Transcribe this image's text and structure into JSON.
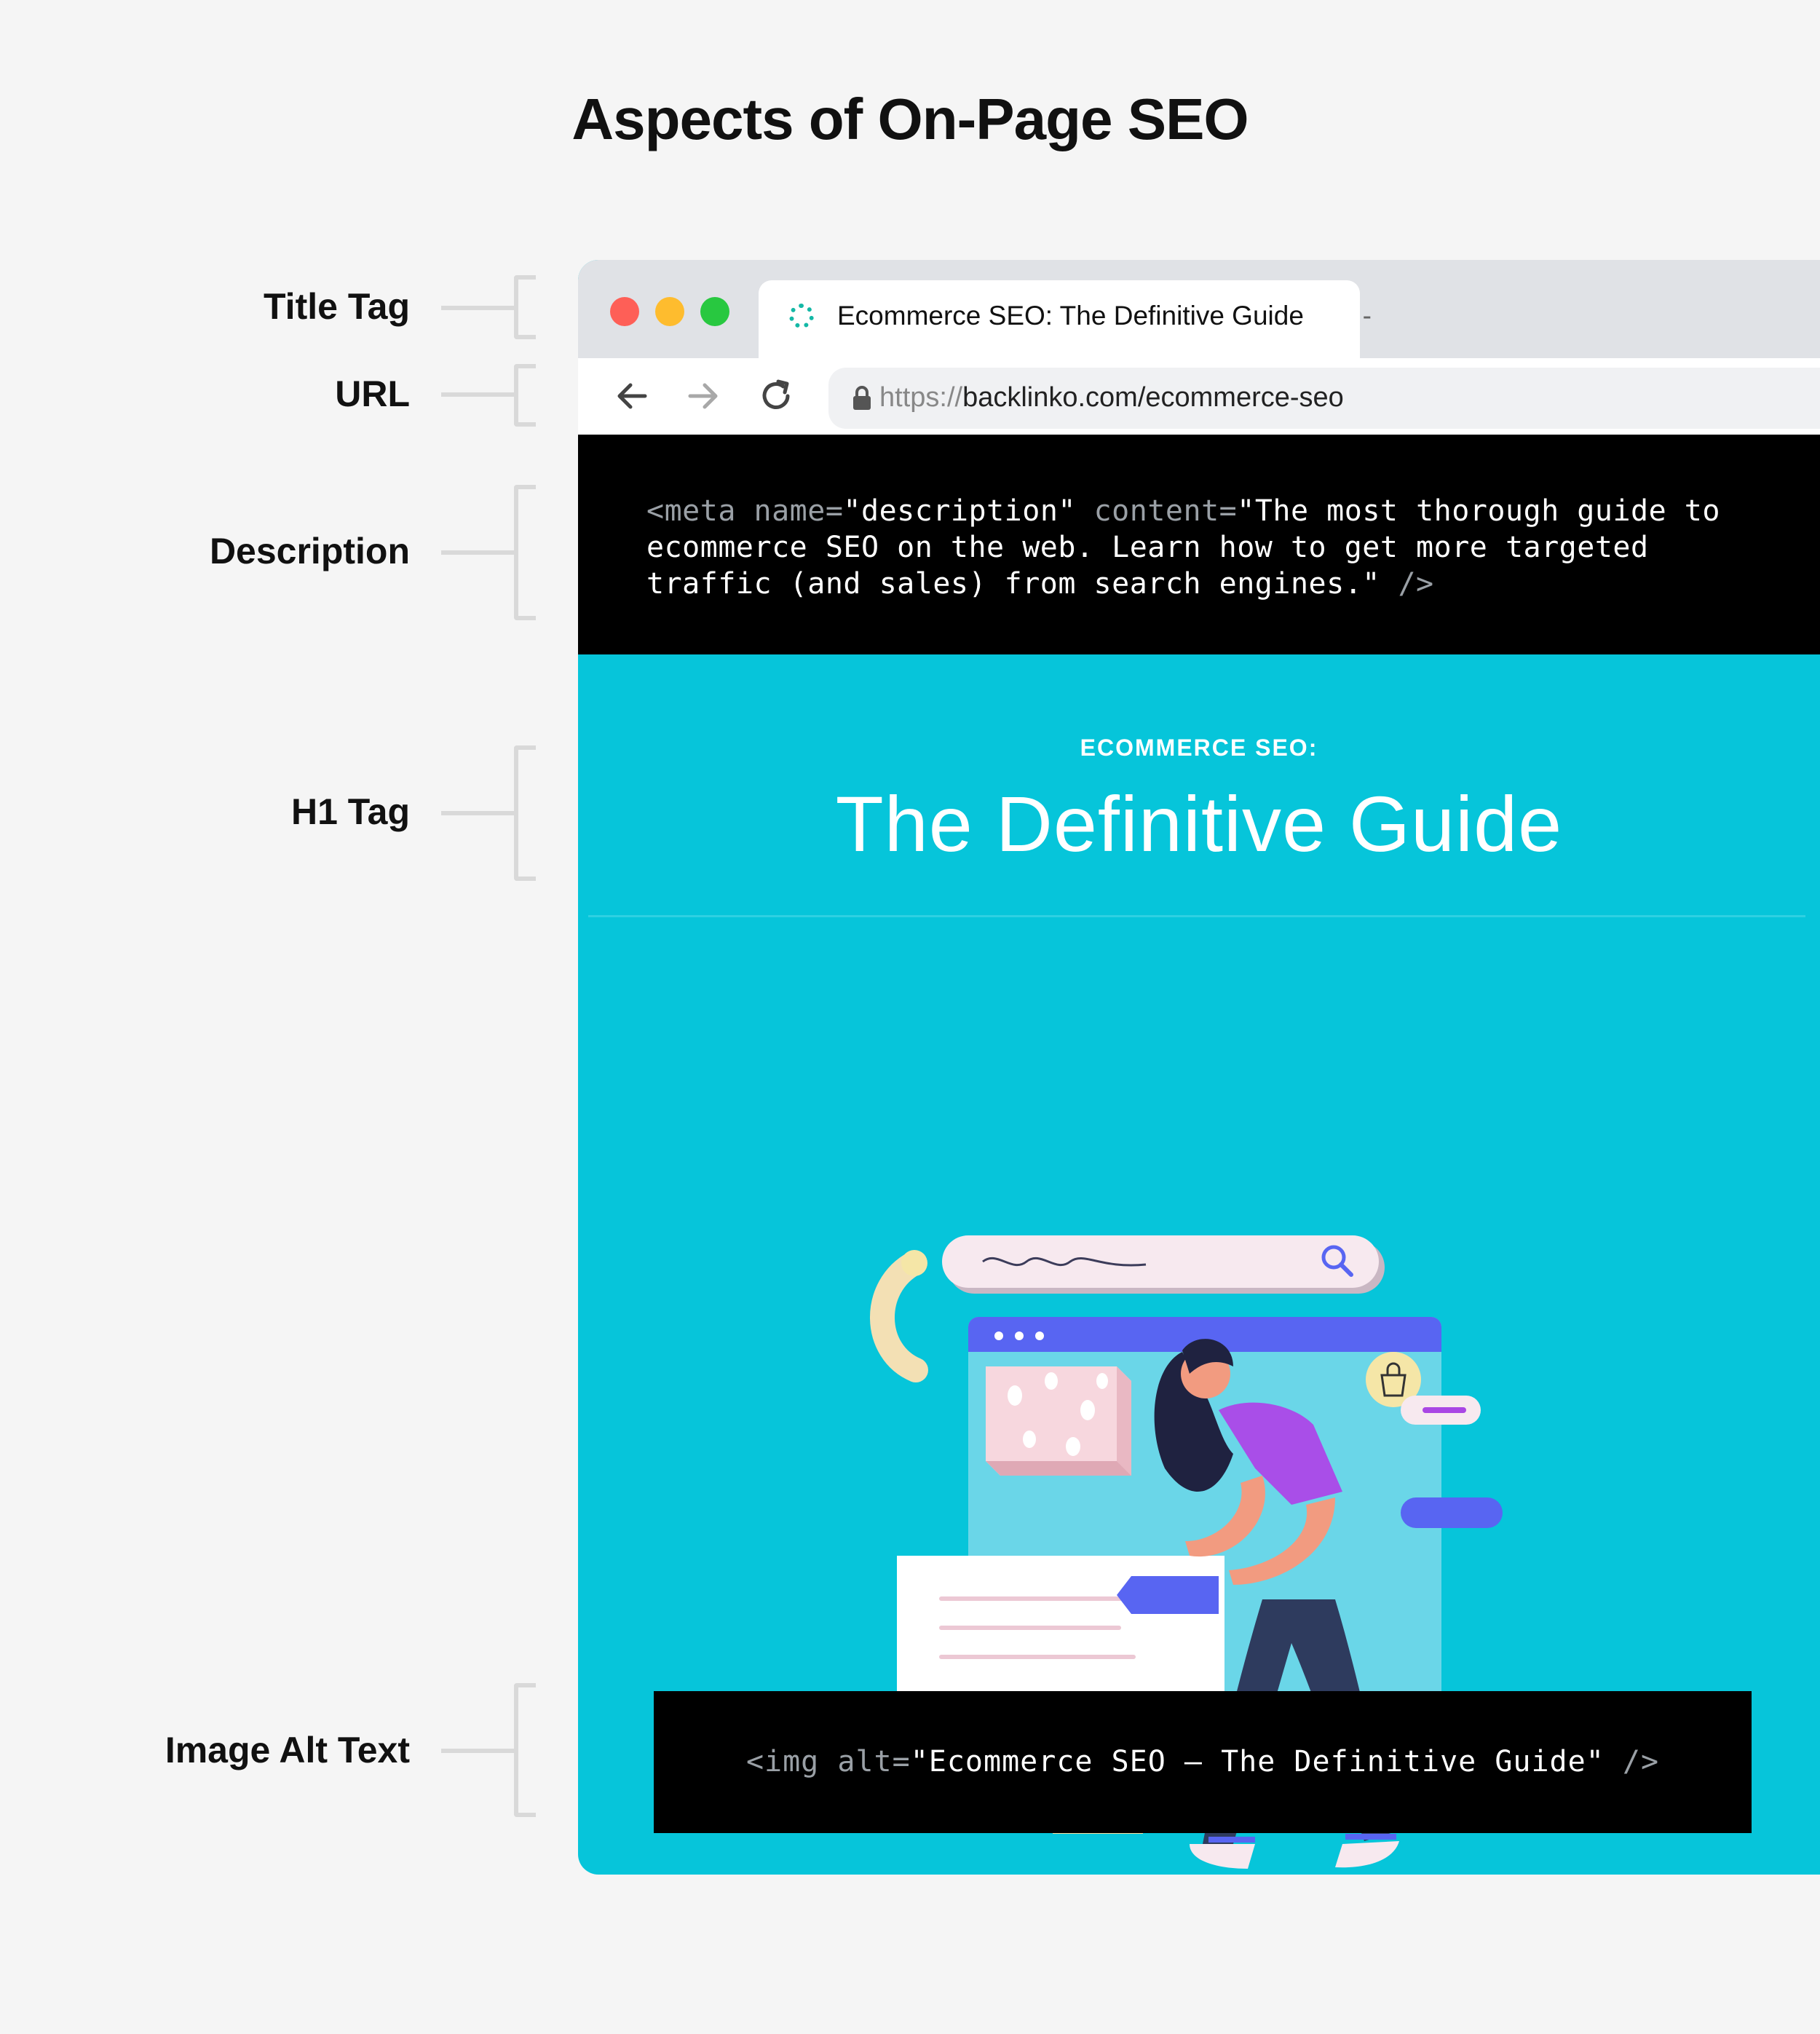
{
  "heading": "Aspects of On-Page SEO",
  "labels": {
    "title_tag": "Title Tag",
    "url": "URL",
    "description": "Description",
    "h1_tag": "H1 Tag",
    "image_alt_text": "Image Alt Text"
  },
  "browser": {
    "tab_title": "Ecommerce SEO: The Definitive Guide",
    "tab_close": "-",
    "url_protocol": "https://",
    "url_rest": "backlinko.com/ecommerce-seo"
  },
  "meta": {
    "open": "<meta",
    "attr1": " name=",
    "val1": "\"description\"",
    "attr2": " content=",
    "val2": "\"The most thorough guide to ecommerce SEO on the web. Learn how to get more targeted traffic (and sales) from search engines.\"",
    "close": " />"
  },
  "page": {
    "eyebrow": "ECOMMERCE SEO:",
    "h1": "The Definitive Guide"
  },
  "alt": {
    "open": "<img",
    "attr": " alt=",
    "val": "\"Ecommerce SEO – The Definitive Guide\"",
    "close": " />"
  },
  "colors": {
    "page_background": "#f5f5f5",
    "hero_background": "#06c5da",
    "code_background": "#000000",
    "traffic_red": "#fe5f57",
    "traffic_yellow": "#febc2e",
    "traffic_green": "#28c840",
    "favicon_teal": "#14b8a6"
  },
  "icons": [
    "back-arrow-icon",
    "forward-arrow-icon",
    "reload-icon",
    "lock-icon",
    "search-icon",
    "shopping-bag-icon",
    "code-brackets-icon"
  ]
}
